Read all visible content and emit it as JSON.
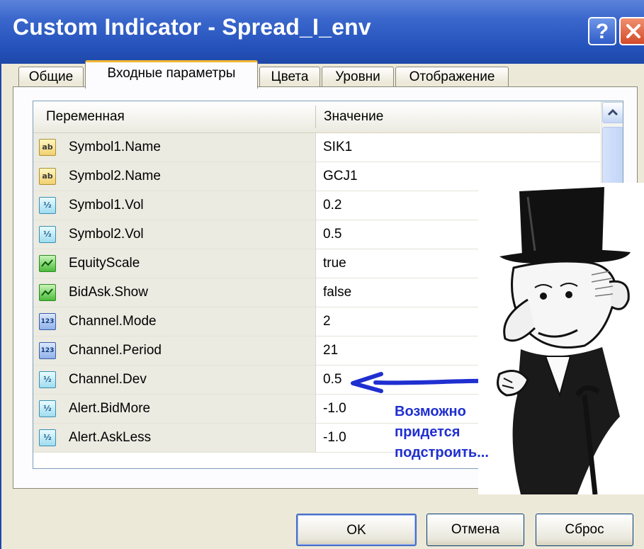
{
  "window": {
    "title": "Custom Indicator - Spread_I_env",
    "help_label": "?"
  },
  "tabs": [
    {
      "label": "Общие"
    },
    {
      "label": "Входные параметры"
    },
    {
      "label": "Цвета"
    },
    {
      "label": "Уровни"
    },
    {
      "label": "Отображение"
    }
  ],
  "active_tab": "Входные параметры",
  "grid": {
    "headers": {
      "variable": "Переменная",
      "value": "Значение"
    },
    "rows": [
      {
        "name": "Symbol1.Name",
        "value": "SIK1",
        "type_icon": "ab"
      },
      {
        "name": "Symbol2.Name",
        "value": "GCJ1",
        "type_icon": "ab"
      },
      {
        "name": "Symbol1.Vol",
        "value": "0.2",
        "type_icon": "½"
      },
      {
        "name": "Symbol2.Vol",
        "value": "0.5",
        "type_icon": "½"
      },
      {
        "name": "EquityScale",
        "value": "true",
        "type_icon": "bool"
      },
      {
        "name": "BidAsk.Show",
        "value": "false",
        "type_icon": "bool"
      },
      {
        "name": "Channel.Mode",
        "value": "2",
        "type_icon": "123"
      },
      {
        "name": "Channel.Period",
        "value": "21",
        "type_icon": "123"
      },
      {
        "name": "Channel.Dev",
        "value": "0.5",
        "type_icon": "½"
      },
      {
        "name": "Alert.BidMore",
        "value": "-1.0",
        "type_icon": "½"
      },
      {
        "name": "Alert.AskLess",
        "value": "-1.0",
        "type_icon": "½"
      }
    ]
  },
  "annotation": {
    "line1": "Возможно",
    "line2": "придется",
    "line3": "подстроить...",
    "color": "#1f2fd0"
  },
  "buttons": {
    "ok": "OK",
    "cancel": "Отмена",
    "reset": "Сброс"
  },
  "colors": {
    "titlebar": "#2452bb",
    "dialog_bg": "#ece9d8",
    "active_tab_accent": "#f2b634",
    "arrow": "#1f2fd0"
  }
}
